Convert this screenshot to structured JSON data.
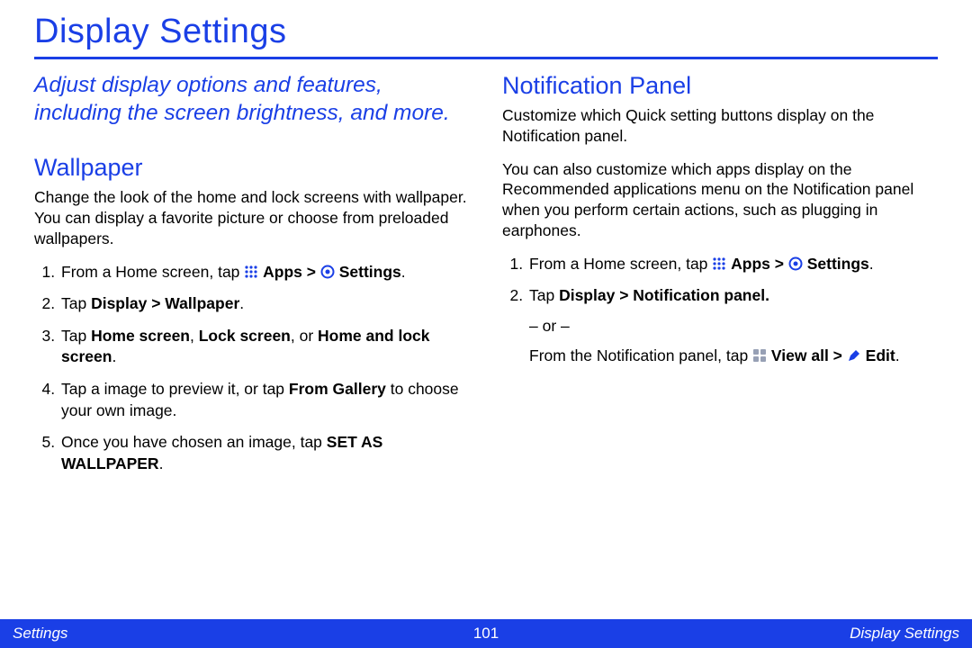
{
  "page_title": "Display Settings",
  "intro": "Adjust display options and features, including the screen brightness, and more.",
  "left": {
    "heading": "Wallpaper",
    "para": "Change the look of the home and lock screens with wallpaper. You can display a favorite picture or choose from preloaded wallpapers.",
    "step1_pre": "From a Home screen, tap ",
    "step1_apps": "Apps",
    "step1_gt": " > ",
    "step1_settings": "Settings",
    "step1_post": ".",
    "step2_pre": "Tap ",
    "step2_path": "Display > Wallpaper",
    "step2_post": ".",
    "step3_pre": "Tap ",
    "step3_b1": "Home screen",
    "step3_sep1": ", ",
    "step3_b2": "Lock screen",
    "step3_sep2": ", or ",
    "step3_b3": "Home and lock screen",
    "step3_post": ".",
    "step4_pre": "Tap a image to preview it, or tap ",
    "step4_b": "From Gallery",
    "step4_post": " to choose your own image.",
    "step5_pre": " Once you have chosen an image, tap ",
    "step5_b": "SET AS WALLPAPER",
    "step5_post": "."
  },
  "right": {
    "heading": "Notification Panel",
    "para1": "Customize which Quick setting buttons display on the Notification panel.",
    "para2": "You can also customize which apps display on the Recommended applications menu on the Notification panel when you perform certain actions, such as plugging in earphones.",
    "step1_pre": "From a Home screen, tap ",
    "step1_apps": "Apps",
    "step1_gt": " > ",
    "step1_settings": "Settings",
    "step1_post": ".",
    "step2_pre": "Tap ",
    "step2_path": "Display > Notification panel.",
    "step2_or": "– or –",
    "step2_from": "From the Notification panel, tap ",
    "step2_viewall": "View all",
    "step2_gt": " > ",
    "step2_edit": "Edit",
    "step2_post": "."
  },
  "footer": {
    "left": "Settings",
    "center": "101",
    "right": "Display Settings"
  }
}
